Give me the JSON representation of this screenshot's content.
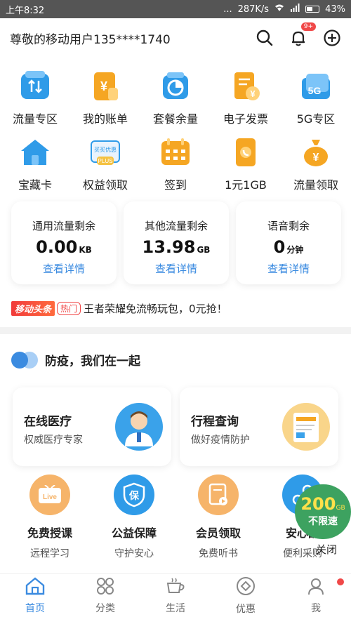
{
  "status_bar": {
    "time": "上午8:32",
    "dots": "...",
    "network_speed": "287K/s",
    "battery": "43%"
  },
  "header": {
    "greeting": "尊敬的移动用户135****1740",
    "notification_badge": "9+"
  },
  "grid": [
    {
      "label": "流量专区",
      "icon": "traffic-icon",
      "color": "#2f9be8"
    },
    {
      "label": "我的账单",
      "icon": "bill-icon",
      "color": "#f5a623"
    },
    {
      "label": "套餐余量",
      "icon": "package-balance-icon",
      "color": "#2f9be8"
    },
    {
      "label": "电子发票",
      "icon": "invoice-icon",
      "color": "#f5a623"
    },
    {
      "label": "5G专区",
      "icon": "5g-icon",
      "color": "#2f9be8"
    },
    {
      "label": "宝藏卡",
      "icon": "house-icon",
      "color": "#2f9be8"
    },
    {
      "label": "权益领取",
      "icon": "rights-icon",
      "color": "#f5c242"
    },
    {
      "label": "签到",
      "icon": "calendar-icon",
      "color": "#f5a623"
    },
    {
      "label": "1元1GB",
      "icon": "phone-icon",
      "color": "#f5a623"
    },
    {
      "label": "流量领取",
      "icon": "money-bag-icon",
      "color": "#f5a623"
    }
  ],
  "rights_icon_text": {
    "top": "买买优惠",
    "bottom": "PLUS"
  },
  "grid_icon_glyphs": {
    "bill": "¥",
    "invoice": "¥",
    "money_bag": "¥",
    "five_g": "5G"
  },
  "cards": [
    {
      "name": "通用流量剩余",
      "value": "0.00",
      "unit": "KB",
      "link": "查看详情"
    },
    {
      "name": "其他流量剩余",
      "value": "13.98",
      "unit": "GB",
      "link": "查看详情"
    },
    {
      "name": "语音剩余",
      "value": "0",
      "unit": "分钟",
      "link": "查看详情"
    }
  ],
  "news": {
    "tag": "移动头条",
    "hot": "热门",
    "text": "王者荣耀免流畅玩包，0元抢！"
  },
  "section": {
    "title": "防疫，我们在一起"
  },
  "features": [
    {
      "title": "在线医疗",
      "subtitle": "权威医疗专家"
    },
    {
      "title": "行程查询",
      "subtitle": "做好疫情防护"
    }
  ],
  "services": [
    {
      "title": "免费授课",
      "subtitle": "远程学习",
      "icon_text": "Live",
      "color": "#f6b46a"
    },
    {
      "title": "公益保障",
      "subtitle": "守护安心",
      "icon_text": "保",
      "color": "#2f9be8"
    },
    {
      "title": "会员领取",
      "subtitle": "免费听书",
      "icon_text": "",
      "color": "#f6b46a"
    },
    {
      "title": "安心配",
      "subtitle": "便利采购",
      "icon_text": "",
      "color": "#2f9be8"
    }
  ],
  "promo": {
    "big": "200",
    "unit": "GB",
    "small": "不限速",
    "close": "关闭"
  },
  "tabs": [
    {
      "label": "首页",
      "active": true
    },
    {
      "label": "分类",
      "active": false
    },
    {
      "label": "生活",
      "active": false
    },
    {
      "label": "优惠",
      "active": false
    },
    {
      "label": "我",
      "active": false
    }
  ],
  "colors": {
    "accent": "#3b8be0",
    "badge": "#f04848",
    "promo_green": "#3da260"
  }
}
